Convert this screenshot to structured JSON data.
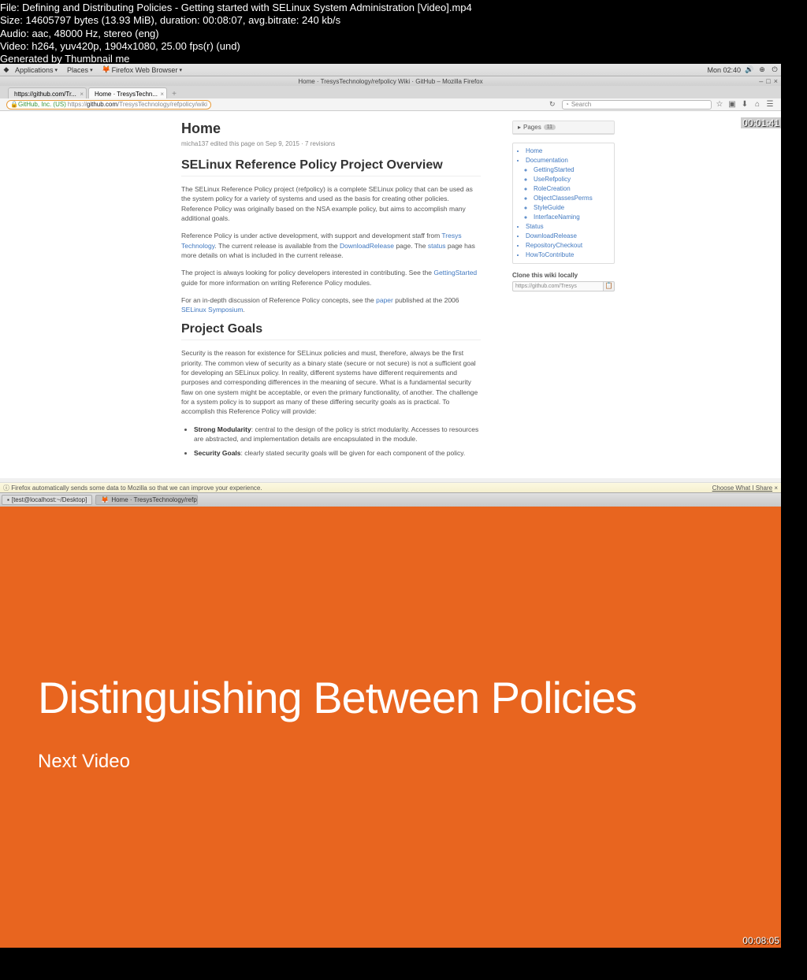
{
  "file_info": {
    "line1": "File: Defining and Distributing Policies - Getting started with SELinux System Administration [Video].mp4",
    "line2": "Size: 14605797 bytes (13.93 MiB), duration: 00:08:07, avg.bitrate: 240 kb/s",
    "line3": "Audio: aac, 48000 Hz, stereo (eng)",
    "line4": "Video: h264, yuv420p, 1904x1080, 25.00 fps(r) (und)",
    "line5": "Generated by Thumbnail me"
  },
  "gnome": {
    "applications": "Applications",
    "places": "Places",
    "firefox": "Firefox Web Browser",
    "clock": "Mon 02:40"
  },
  "firefox": {
    "title": "Home · TresysTechnology/refpolicy Wiki · GitHub – Mozilla Firefox",
    "tabs": [
      {
        "label": "https://github.com/Tr..."
      },
      {
        "label": "Home · TresysTechn..."
      }
    ],
    "url_prefix": "GitHub, Inc. (US)",
    "url_gray1": "https://",
    "url_black": "github.com",
    "url_gray2": "/TresysTechnology/refpolicy/wiki",
    "search_placeholder": "Search",
    "infobar": "Firefox automatically sends some data to Mozilla so that we can improve your experience.",
    "infobar_link": "Choose What I Share"
  },
  "wiki": {
    "title": "Home",
    "meta": "micha137 edited this page on Sep 9, 2015 · 7 revisions",
    "h2a": "SELinux Reference Policy Project Overview",
    "p1": "The SELinux Reference Policy project (refpolicy) is a complete SELinux policy that can be used as the system policy for a variety of systems and used as the basis for creating other policies. Reference Policy was originally based on the NSA example policy, but aims to accomplish many additional goals.",
    "p2a": "Reference Policy is under active development, with support and development staff from ",
    "p2_link1": "Tresys Technology",
    "p2b": ". The current release is available from the ",
    "p2_link2": "DownloadRelease",
    "p2c": " page. The ",
    "p2_link3": "status",
    "p2d": " page has more details on what is included in the current release.",
    "p3a": "The project is always looking for policy developers interested in contributing. See the ",
    "p3_link1": "GettingStarted",
    "p3b": " guide for more information on writing Reference Policy modules.",
    "p4a": "For an in-depth discussion of Reference Policy concepts, see the ",
    "p4_link1": "paper",
    "p4b": " published at the 2006 ",
    "p4_link2": "SELinux Symposium",
    "p4c": ".",
    "h2b": "Project Goals",
    "p5": "Security is the reason for existence for SELinux policies and must, therefore, always be the first priority. The common view of security as a binary state (secure or not secure) is not a sufficient goal for developing an SELinux policy. In reality, different systems have different requirements and purposes and corresponding differences in the meaning of secure. What is a fundamental security flaw on one system might be acceptable, or even the primary functionality, of another. The challenge for a system policy is to support as many of these differing security goals as is practical. To accomplish this Reference Policy will provide:",
    "li1b": "Strong Modularity",
    "li1": ": central to the design of the policy is strict modularity. Accesses to resources are abstracted, and implementation details are encapsulated in the module.",
    "li2b": "Security Goals",
    "li2": ": clearly stated security goals will be given for each component of the policy.",
    "side": {
      "pages": "Pages",
      "pages_count": "11",
      "items": [
        "Home",
        "Documentation",
        "GettingStarted",
        "UseRefpolicy",
        "RoleCreation",
        "ObjectClassesPerms",
        "StyleGuide",
        "InterfaceNaming",
        "Status",
        "DownloadRelease",
        "RepositoryCheckout",
        "HowToContribute"
      ],
      "clone_label": "Clone this wiki locally",
      "clone_url": "https://github.com/Tresys"
    }
  },
  "taskbar": {
    "term": "[test@localhost:~/Desktop]",
    "ff": "Home · TresysTechnology/refpoli..."
  },
  "timestamps": {
    "top": "00:01:41",
    "bottom": "00:08:05"
  },
  "slide": {
    "title": "Distinguishing Between Policies",
    "sub": "Next Video"
  }
}
